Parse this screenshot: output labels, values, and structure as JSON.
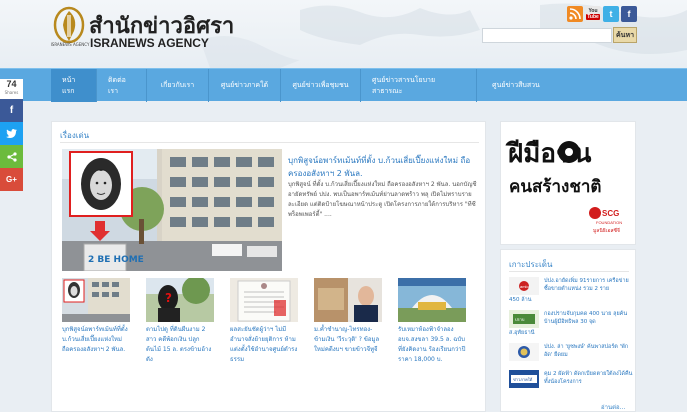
{
  "header": {
    "brand_thai": "สำนักข่าวอิศรา",
    "brand_en": "ISRANEWS AGENCY",
    "logo_caption": "ISRANEWS AGENCY",
    "search_placeholder": "",
    "search_button": "ค้นหา"
  },
  "social": {
    "rss": "RSS",
    "youtube_top": "You",
    "youtube_bottom": "Tube",
    "twitter": "t",
    "facebook": "f"
  },
  "nav": {
    "items": [
      {
        "label": "หน้าแรก",
        "active": true
      },
      {
        "label": "ติดต่อเรา"
      },
      {
        "label": "เกี่ยวกับเรา"
      },
      {
        "label": "ศูนย์ข่าวภาคใต้"
      },
      {
        "label": "ศูนย์ข่าวเพื่อชุมชน"
      },
      {
        "label": "ศูนย์ข่าวสารนโยบายสาธารณะ"
      },
      {
        "label": "ศูนย์ข่าวสืบสวน"
      }
    ]
  },
  "share": {
    "count": "74",
    "label": "Shares",
    "fb": "f",
    "tw": "t",
    "sh": "<",
    "gp": "G+"
  },
  "main": {
    "section_title": "เรื่องเด่น",
    "feature": {
      "title": "บุกพิสูจน์อพาร์ทเม้นท์ที่ตั้ง บ.ก้วนเสี่ยเปี๊ยงแห่งใหม่ ถือครองอสังหาฯ 2 พันล.",
      "body": "บุกพิสูจน์ ที่ตั้ง บ.ก้วนเสี่ยเปี๊ยงแห่งใหม่ ถือครองอสังหาฯ 2 พันล. นอกบัญชีอายัดทรัพย์ ปปง. พบเป็นอพาร์ทเม้นท์ย่านลาดพร้าว พลุ เปิดไม่ทราบรายละเอียด แต่ติดป้ายโฆษณาหน้าประตู เปิดโครงการภายใต้การบริหาร \"ทีซี พร็อพเพอร์ตี้\" ....",
      "sign_text": "2 BE HOME"
    },
    "thumbs": [
      {
        "caption": "บุกพิสูจน์อพาร์ทเม้นท์ที่ตั้ง บ.ก้วนเสี่ยเปี๊ยงแห่งใหม่ ถือครองอสังหาฯ 2 พันล."
      },
      {
        "caption": "ตามไปดู ที่ดินผืนงาม 2 สาว คดีพ้อกเงิน ปลูกต้นไม้ 15 ล. ตรงข้ามอ้างดัง"
      },
      {
        "caption": "ผลสะยันชัดผู้ว่าฯ ไม่มีอำนาจสั่งย้ายยุติการ ห้ามแต่งตั้งใช้อำนาจศูนย์ดำรงธรรม"
      },
      {
        "caption": "ม.ค้ำชำนาญ-ไทรทอง-ข้ามเงิน 'วีระวุติ' ? ข้อมูลใหม่คดีงบฯ ขายข้าวจีทูจี"
      },
      {
        "caption": "รับเหมาห้องฟ้าจำลอง อบจ.สงขลา 39.5 ล. ฉบับที่ยังคิดงาน ร้องเรียนกว่าปี ราคา 18,000 บ."
      }
    ]
  },
  "ad": {
    "line1": "ฝีมือชน",
    "line2": "คนสร้างชาติ",
    "scg": "SCG",
    "foundation": "FOUNDATION",
    "thai_foundation": "มูลนิธิเอสซีจี"
  },
  "right": {
    "title": "เกาะประเด็น",
    "items": [
      {
        "text": "ปปง.อายัดเพิ่ม 91รายการ เครือข่ายซื้อขายตำแหน่ง รวม 2 ราย",
        "sub": "450 ล้าน"
      },
      {
        "text": "กองปราบจับกุมคด 400 นาย ลุยค้นบ้านผู้มีอิทธิพล 30 จุด",
        "sub": "ส.อุทัยธานี"
      },
      {
        "text": "ปปง. ล่า 'ยูซพงษ์' ค้นพาสปอร์ต 'พักอัด' ยืดยม",
        "sub": ""
      },
      {
        "text": "คุม 2 ผัดฟ้า ดัดกเบียดตายใต้ลงได้คืนทั้งน้องโครงการ",
        "sub": ""
      }
    ],
    "more": "อ่านต่อ..."
  }
}
